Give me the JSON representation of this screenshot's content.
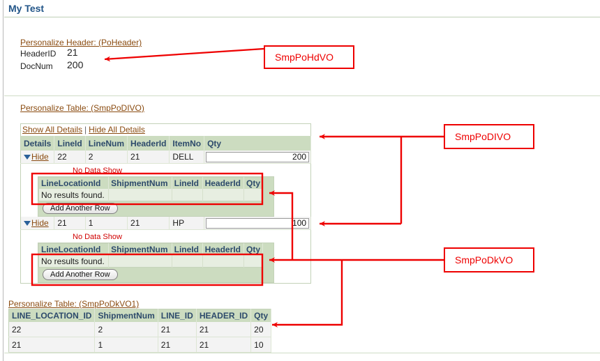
{
  "page": {
    "title": "My Test"
  },
  "header_region": {
    "personalize_link": "Personalize Header: (PoHeader)",
    "fields": [
      {
        "label": "HeaderID",
        "value": "21"
      },
      {
        "label": "DocNum",
        "value": "200"
      }
    ]
  },
  "main_table": {
    "personalize_link": "Personalize Table: (SmpPoDIVO)",
    "show_all_details": "Show All Details",
    "separator": "|",
    "hide_all_details": "Hide All Details",
    "columns": [
      "Details",
      "LineId",
      "LineNum",
      "HeaderId",
      "ItemNo",
      "Qty"
    ],
    "rows": [
      {
        "details_toggle": "Hide",
        "line_id": "22",
        "line_num": "2",
        "header_id": "21",
        "item_no": "DELL",
        "qty": "200",
        "detail": {
          "note": "No Data Show",
          "columns": [
            "LineLocationId",
            "ShipmentNum",
            "LineId",
            "HeaderId",
            "Qty"
          ],
          "empty_message": "No results found.",
          "add_row_button": "Add Another Row"
        }
      },
      {
        "details_toggle": "Hide",
        "line_id": "21",
        "line_num": "1",
        "header_id": "21",
        "item_no": "HP",
        "qty": "100",
        "detail": {
          "note": "No Data Show",
          "columns": [
            "LineLocationId",
            "ShipmentNum",
            "LineId",
            "HeaderId",
            "Qty"
          ],
          "empty_message": "No results found.",
          "add_row_button": "Add Another Row"
        }
      }
    ]
  },
  "bottom_table": {
    "personalize_link": "Personalize Table: (SmpPoDkVO1)",
    "columns": [
      "LINE_LOCATION_ID",
      "ShipmentNum",
      "LINE_ID",
      "HEADER_ID",
      "Qty"
    ],
    "rows": [
      [
        "22",
        "2",
        "21",
        "21",
        "20"
      ],
      [
        "21",
        "1",
        "21",
        "21",
        "10"
      ]
    ]
  },
  "annotations": {
    "color": "#ee0000",
    "labels": [
      {
        "text": "SmpPoHdVO"
      },
      {
        "text": "SmpPoDIVO"
      },
      {
        "text": "SmpPoDkVO"
      }
    ]
  }
}
